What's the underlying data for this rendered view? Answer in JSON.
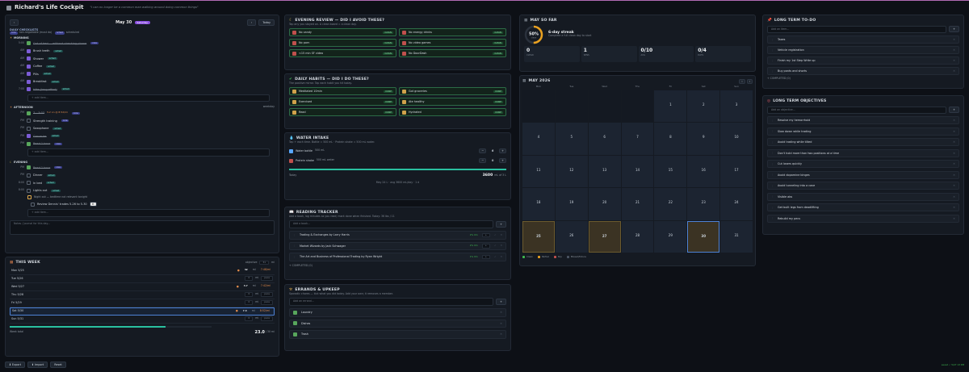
{
  "app": {
    "title": "Richard's Life Cockpit",
    "tagline": "\"I can no longer be a common man walking around doing common things\""
  },
  "day": {
    "date": "May 30",
    "weekday": "Saturday",
    "today_btn": "Today",
    "section": "DAILY CHECKLISTS",
    "negotiable": "non-negotiable (must do)",
    "scheduled": "scheduled",
    "notes_placeholder": "Notes / journal for this day..."
  },
  "morning": {
    "title": "MORNING",
    "items": [
      {
        "time": "5:00",
        "label": "Out of bed — without checking phone",
        "tag": "core",
        "done": true,
        "strike": true
      },
      {
        "time": "AM",
        "label": "Brush teeth",
        "tag": "sched",
        "done": true
      },
      {
        "time": "AM",
        "label": "Shower",
        "tag": "sched",
        "done": true
      },
      {
        "time": "AM",
        "label": "Coffee",
        "tag": "sched",
        "done": true
      },
      {
        "time": "AM",
        "label": "Pills",
        "tag": "sched",
        "done": true
      },
      {
        "time": "AM",
        "label": "Breakfast",
        "tag": "sched",
        "done": true
      },
      {
        "time": "7:00",
        "label": "Hike (long effort)",
        "tag": "sched",
        "done": true,
        "strike": true
      }
    ],
    "add": "+ add item..."
  },
  "afternoon": {
    "title": "AFTERNOON",
    "extra": "weekday",
    "items": [
      {
        "time": "PM",
        "label": "7 – 3:03",
        "tag": "core",
        "done": true,
        "strike": true,
        "note": "5.2 on @ 8:52/mi"
      },
      {
        "time": "PM",
        "label": "Strength training",
        "tag": "core",
        "done": false
      },
      {
        "time": "PM",
        "label": "Saxophone",
        "tag": "sched",
        "done": false
      },
      {
        "time": "PM",
        "label": "Groceries",
        "tag": "sched",
        "done": true,
        "strike": true
      },
      {
        "time": "PM",
        "label": "Read 1 hour",
        "tag": "core",
        "done": true,
        "strike": true
      }
    ],
    "add": "+ add item..."
  },
  "evening": {
    "title": "EVENING",
    "items": [
      {
        "time": "PM",
        "label": "Read 1 hour",
        "tag": "core",
        "done": true,
        "strike": true
      },
      {
        "time": "PM",
        "label": "Dinner",
        "tag": "sched",
        "done": false
      },
      {
        "time": "8:00",
        "label": "In bed",
        "tag": "sched",
        "done": false
      },
      {
        "time": "8:00",
        "label": "Lights out",
        "tag": "sched",
        "done": false
      }
    ],
    "night_out": "Night out — bedtime not relevant tonight",
    "review": "Review Dennis' trades 5-26 to 5-30",
    "add": "+ add item..."
  },
  "week": {
    "title": "THIS WEEK",
    "objective_label": "objective",
    "objective_val": "31",
    "unit": "mi",
    "rows": [
      {
        "day": "Mon 5/25",
        "val": "32",
        "unit": "mi",
        "pace": "7:48/mi"
      },
      {
        "day": "Tue 5/26",
        "val": "0",
        "unit": "mi",
        "pace": "pace"
      },
      {
        "day": "Wed 5/27",
        "val": "3.7",
        "unit": "mi",
        "pace": "7:42/mi"
      },
      {
        "day": "Thu 5/28",
        "val": "0",
        "unit": "mi",
        "pace": "pace"
      },
      {
        "day": "Fri 5/29",
        "val": "0",
        "unit": "mi",
        "pace": "pace"
      },
      {
        "day": "Sat 5/30",
        "val": "7.3",
        "unit": "mi",
        "pace": "8:52/mi"
      },
      {
        "day": "Sun 5/31",
        "val": "0",
        "unit": "mi",
        "pace": "pace"
      }
    ],
    "total_label": "Week total",
    "total": "23.0",
    "total_of": "/ 30 mi",
    "progress": 0.77
  },
  "footer": {
    "export": "Export",
    "import": "Import",
    "reset": "Reset",
    "saved": "saved ✓ 5/27 13 PM"
  },
  "avoid": {
    "title": "EVENING REVIEW — DID I AVOID THESE?",
    "sub": "Tap any you stayed on. A clean board = a clean day.",
    "items": [
      {
        "label": "No candy",
        "state": "CLEAN"
      },
      {
        "label": "No energy drinks",
        "state": "CLEAN"
      },
      {
        "label": "No porn",
        "state": "CLEAN"
      },
      {
        "label": "No video games",
        "state": "CLEAN"
      },
      {
        "label": "<15 min SF video",
        "state": "CLEAN"
      },
      {
        "label": "No DoorDash",
        "state": "CLEAN"
      }
    ]
  },
  "habits": {
    "title": "DAILY HABITS — DID I DO THESE?",
    "sub": "The positive mirror. Tap each habit you hit today.",
    "items": [
      {
        "label": "Meditated 10min",
        "state": "DONE"
      },
      {
        "label": "Got groceries",
        "state": "DONE"
      },
      {
        "label": "Exercised",
        "state": "DONE"
      },
      {
        "label": "Ate healthy",
        "state": "DONE"
      },
      {
        "label": "Read",
        "state": "DONE"
      },
      {
        "label": "Hydrated",
        "state": "DONE"
      }
    ]
  },
  "water": {
    "title": "WATER INTAKE",
    "sub": "Tap + each time. Bottle = 500 mL · Protein shake = 500 mL water.",
    "rows": [
      {
        "label": "Water bottle",
        "sub": "500 mL",
        "count": "6"
      },
      {
        "label": "Protein shake",
        "sub": "500 mL water",
        "count": "0"
      }
    ],
    "today": "Today",
    "amount": "3600",
    "of": "mL of 3 L",
    "progress": 1.0,
    "avg": "May 24 L · avg 3600 mL/day · 1 d"
  },
  "reading": {
    "title": "READING TRACKER",
    "sub": "Add a book, log minutes as you read; mark done when finished. Today: 36 Ibs / 11",
    "placeholder": "Add a book...",
    "books": [
      {
        "title": "Trading & Exchanges by Larry Harris",
        "pct": "2% 0m"
      },
      {
        "title": "Market Wizards by Jack Schwager",
        "pct": "2% 0m"
      },
      {
        "title": "The Art and Business of Professional Trading by Ryan Wright",
        "pct": "1% 0m"
      }
    ],
    "completed": "+ COMPLETED (0)"
  },
  "errands": {
    "title": "ERRANDS & UPKEEP",
    "sub": "Sporadic chores — tick what you did today. Add your own; it removes a member.",
    "placeholder": "Add an errand...",
    "items": [
      "Laundry",
      "Dishes",
      "Trash"
    ]
  },
  "sofar": {
    "title": "MAY SO FAR",
    "pct": "50%",
    "pct_sub": "clean",
    "streak": "6-day streak",
    "streak_sub": "Complete a full clean day to start",
    "pct_value": 0.5,
    "stats": [
      {
        "val": "0",
        "label": "CLEAN"
      },
      {
        "val": "1",
        "label": "WINS"
      },
      {
        "val": "0/10",
        "label": "AVG"
      },
      {
        "val": "0/4",
        "label": "DAYS"
      }
    ]
  },
  "calendar": {
    "title": "MAY 2026",
    "days": [
      "Mon",
      "Tue",
      "Wed",
      "Thu",
      "Fri",
      "Sat",
      "Sun"
    ],
    "cells": [
      "",
      "",
      "",
      "",
      "1",
      "2",
      "3",
      "4",
      "5",
      "6",
      "7",
      "8",
      "9",
      "10",
      "11",
      "12",
      "13",
      "14",
      "15",
      "16",
      "17",
      "18",
      "19",
      "20",
      "21",
      "22",
      "23",
      "24",
      "25",
      "26",
      "27",
      "28",
      "29",
      "30",
      "31"
    ],
    "legend": [
      "Clean",
      "Partial",
      "Slip",
      "Missed/future"
    ]
  },
  "longtodo": {
    "title": "LONG TERM TO-DO",
    "placeholder": "Add an item...",
    "items": [
      "Taxes",
      "Vehicle registration",
      "Finish my 1st Step Write up",
      "Buy pants and shorts"
    ],
    "completed": "+ COMPLETED (0)"
  },
  "objectives": {
    "title": "LONG TERM OBJECTIVES",
    "placeholder": "Add an objective...",
    "items": [
      "Resolve my hemorrhoid",
      "Slow down while trading",
      "Avoid trading while tilted",
      "Don't hold more than two positions at a time",
      "Cut losers quickly",
      "Avoid dopamine binges",
      "Avoid tunneling into a cave",
      "Visible abs",
      "Get built legs from deadlifting",
      "Rebuild my pecs"
    ]
  }
}
